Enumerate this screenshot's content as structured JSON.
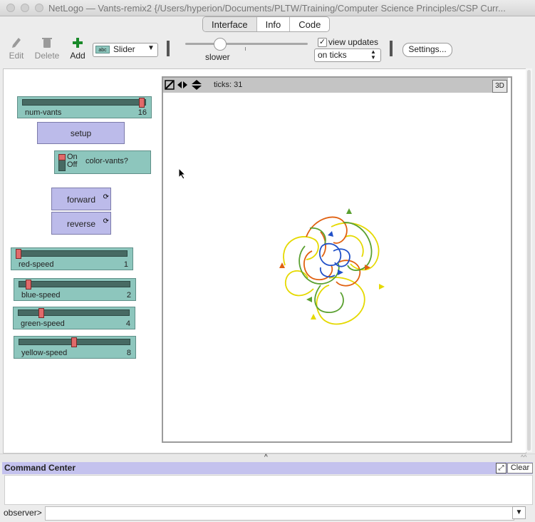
{
  "window": {
    "title": "NetLogo — Vants-remix2 {/Users/hyperion/Documents/PLTW/Training/Computer Science Principles/CSP Curr..."
  },
  "tabs": [
    {
      "label": "Interface"
    },
    {
      "label": "Info"
    },
    {
      "label": "Code"
    }
  ],
  "toolbar": {
    "edit_label": "Edit",
    "delete_label": "Delete",
    "add_label": "Add",
    "widget_type": "Slider",
    "widget_type_icon": "abc",
    "speed_label": "slower",
    "speed_value": 0.28,
    "view_updates_label": "view updates",
    "view_updates_checked": true,
    "checkmark": "✓",
    "update_mode": "on ticks",
    "settings_label": "Settings..."
  },
  "widgets": {
    "num_vants": {
      "label": "num-vants",
      "value": "16",
      "fraction": 1.0
    },
    "setup": {
      "label": "setup"
    },
    "color_vants": {
      "label": "color-vants?",
      "on": "On",
      "off": "Off"
    },
    "forward": {
      "label": "forward"
    },
    "reverse": {
      "label": "reverse"
    },
    "red_speed": {
      "label": "red-speed",
      "value": "1",
      "fraction": 0.0
    },
    "blue_speed": {
      "label": "blue-speed",
      "value": "2",
      "fraction": 0.07
    },
    "green_speed": {
      "label": "green-speed",
      "value": "4",
      "fraction": 0.2
    },
    "yellow_speed": {
      "label": "yellow-speed",
      "value": "8",
      "fraction": 0.5
    }
  },
  "view": {
    "ticks_label": "ticks: 31",
    "btn_3d": "3D",
    "trail_colors": [
      "#e5d900",
      "#e06010",
      "#5aa030",
      "#2050c8"
    ]
  },
  "command_center": {
    "title": "Command Center",
    "clear_label": "Clear",
    "observer_label": "observer>",
    "input_value": ""
  }
}
